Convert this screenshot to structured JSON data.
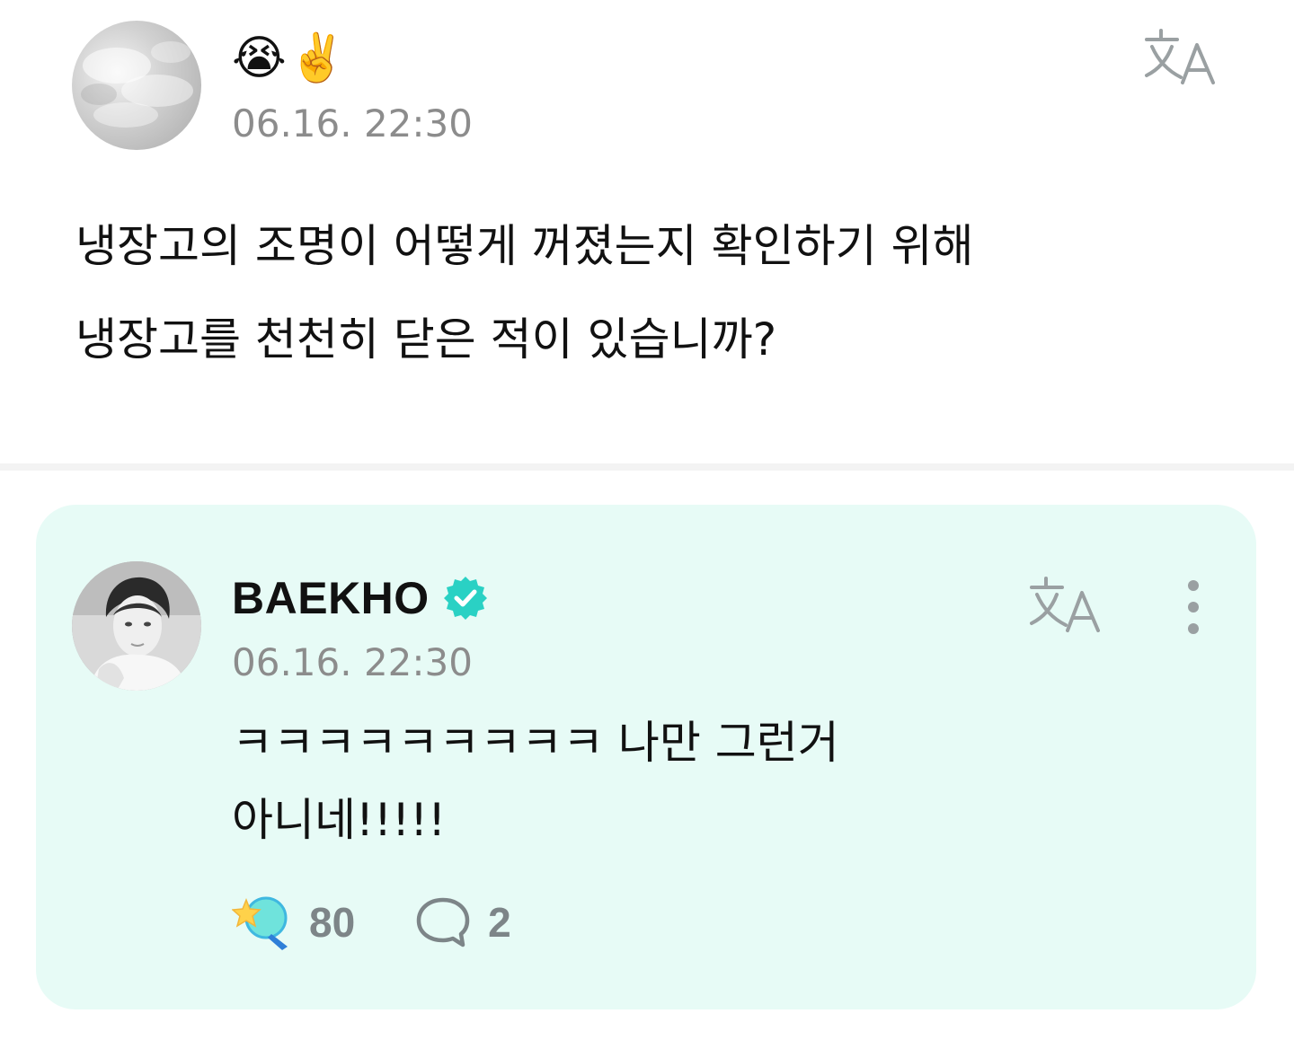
{
  "post": {
    "avatar": "cloud-avatar-image",
    "emoji": "😭✌️",
    "timestamp": "06.16. 22:30",
    "translate_icon": "translate-icon",
    "body_lines": [
      "냉장고의 조명이 어떻게 꺼졌는지 확인하기 위해",
      "냉장고를 천천히 닫은 적이 있습니까?"
    ]
  },
  "comment": {
    "author": "BAEKHO",
    "verified_icon": "verified-badge-icon",
    "timestamp": "06.16. 22:30",
    "translate_icon": "translate-icon",
    "more_icon": "more-vertical-icon",
    "body_lines": [
      "ㅋㅋㅋㅋㅋㅋㅋㅋㅋ 나만 그런거",
      "아니네!!!!!"
    ],
    "likes": {
      "icon": "star-lightstick-icon",
      "count": "80"
    },
    "replies": {
      "icon": "speech-bubble-icon",
      "count": "2"
    }
  },
  "colors": {
    "card_background": "#e7fbf6",
    "timestamp": "#8c8c8c",
    "verified": "#2ad1c4",
    "icon_gray": "#9aa0a2",
    "divider": "#f3f3f3"
  }
}
